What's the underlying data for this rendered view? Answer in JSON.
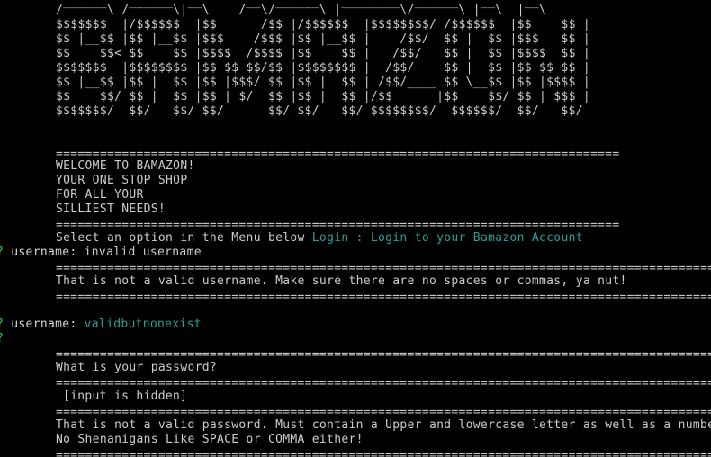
{
  "colors": {
    "background": "#000000",
    "text": "#cccccc",
    "prompt_mark": "#3fbf3f",
    "selected": "#2a9d96"
  },
  "banner": {
    "ascii_lines": [
      " ______   ______  __      __  ______   ________  ______   __    __",
      "/      \\ /      \\|  \\    /  \\/      \\ |        \\/      \\ |  \\  |  \\",
      "$$$$$$$  |/$$$$$$  |$$      /$$ |/$$$$$$  |$$$$$$$$/ /$$$$$$  |$$    $$ |",
      "$$ |__$$ |$$ |__$$ |$$$    /$$$ |$$ |__$$ |    /$$/  $$ |  $$ |$$$   $$ |",
      "$$    $$< $$    $$ |$$$$  /$$$$ |$$    $$ |   /$$/   $$ |  $$ |$$$$  $$ |",
      "$$$$$$$  |$$$$$$$$ |$$ $$ $$/$$ |$$$$$$$$ |  /$$/    $$ |  $$ |$$ $$ $$ |",
      "$$ |__$$ |$$ |  $$ |$$ |$$$/ $$ |$$ |  $$ | /$$/____ $$ \\__$$ |$$ |$$$$ |",
      "$$    $$/ $$ |  $$ |$$ | $/  $$ |$$ |  $$ |/$$      |$$    $$/ $$ | $$$ |",
      "$$$$$$$/  $$/   $$/ $$/      $$/ $$/   $$/ $$$$$$$$/  $$$$$$/  $$/   $$/"
    ],
    "rule": "=============================================================================",
    "welcome_lines": [
      "WELCOME TO BAMAZON!",
      "YOUR ONE STOP SHOP",
      "FOR ALL YOUR",
      "SILLIEST NEEDS!"
    ]
  },
  "menu": {
    "prompt": "Select an option in the Menu below",
    "selected": "Login : Login to your Bamazon Account"
  },
  "session": {
    "question_mark": "?",
    "username_label": "username:",
    "first_username_value": "invalid username",
    "long_rule": "==================================================================================================",
    "invalid_username_msg": "That is not a valid username. Make sure there are no spaces or commas, ya nut!",
    "second_username_value": "validbutnonexist",
    "password_question": "What is your password?",
    "hidden_input": "[input is hidden]",
    "invalid_password_msg_1": "That is not a valid password. Must contain a Upper and lowercase letter as well as a number",
    "invalid_password_msg_2": "No Shenanigans Like SPACE or COMMA either!"
  }
}
